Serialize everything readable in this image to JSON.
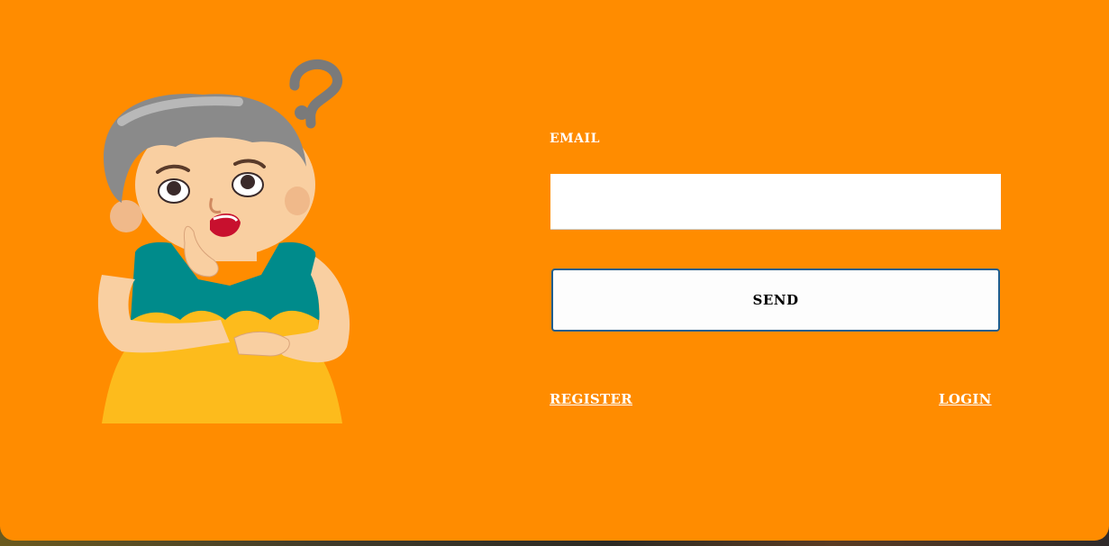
{
  "form": {
    "email_label": "EMAIL",
    "email_value": "",
    "send_label": "SEND"
  },
  "links": {
    "register": "REGISTER",
    "login": "LOGIN"
  },
  "illustration": {
    "icon": "confused-grandmother-illustration"
  },
  "colors": {
    "background": "#ff8c00",
    "text": "#ffffff",
    "button_border": "#1f5e8f"
  }
}
